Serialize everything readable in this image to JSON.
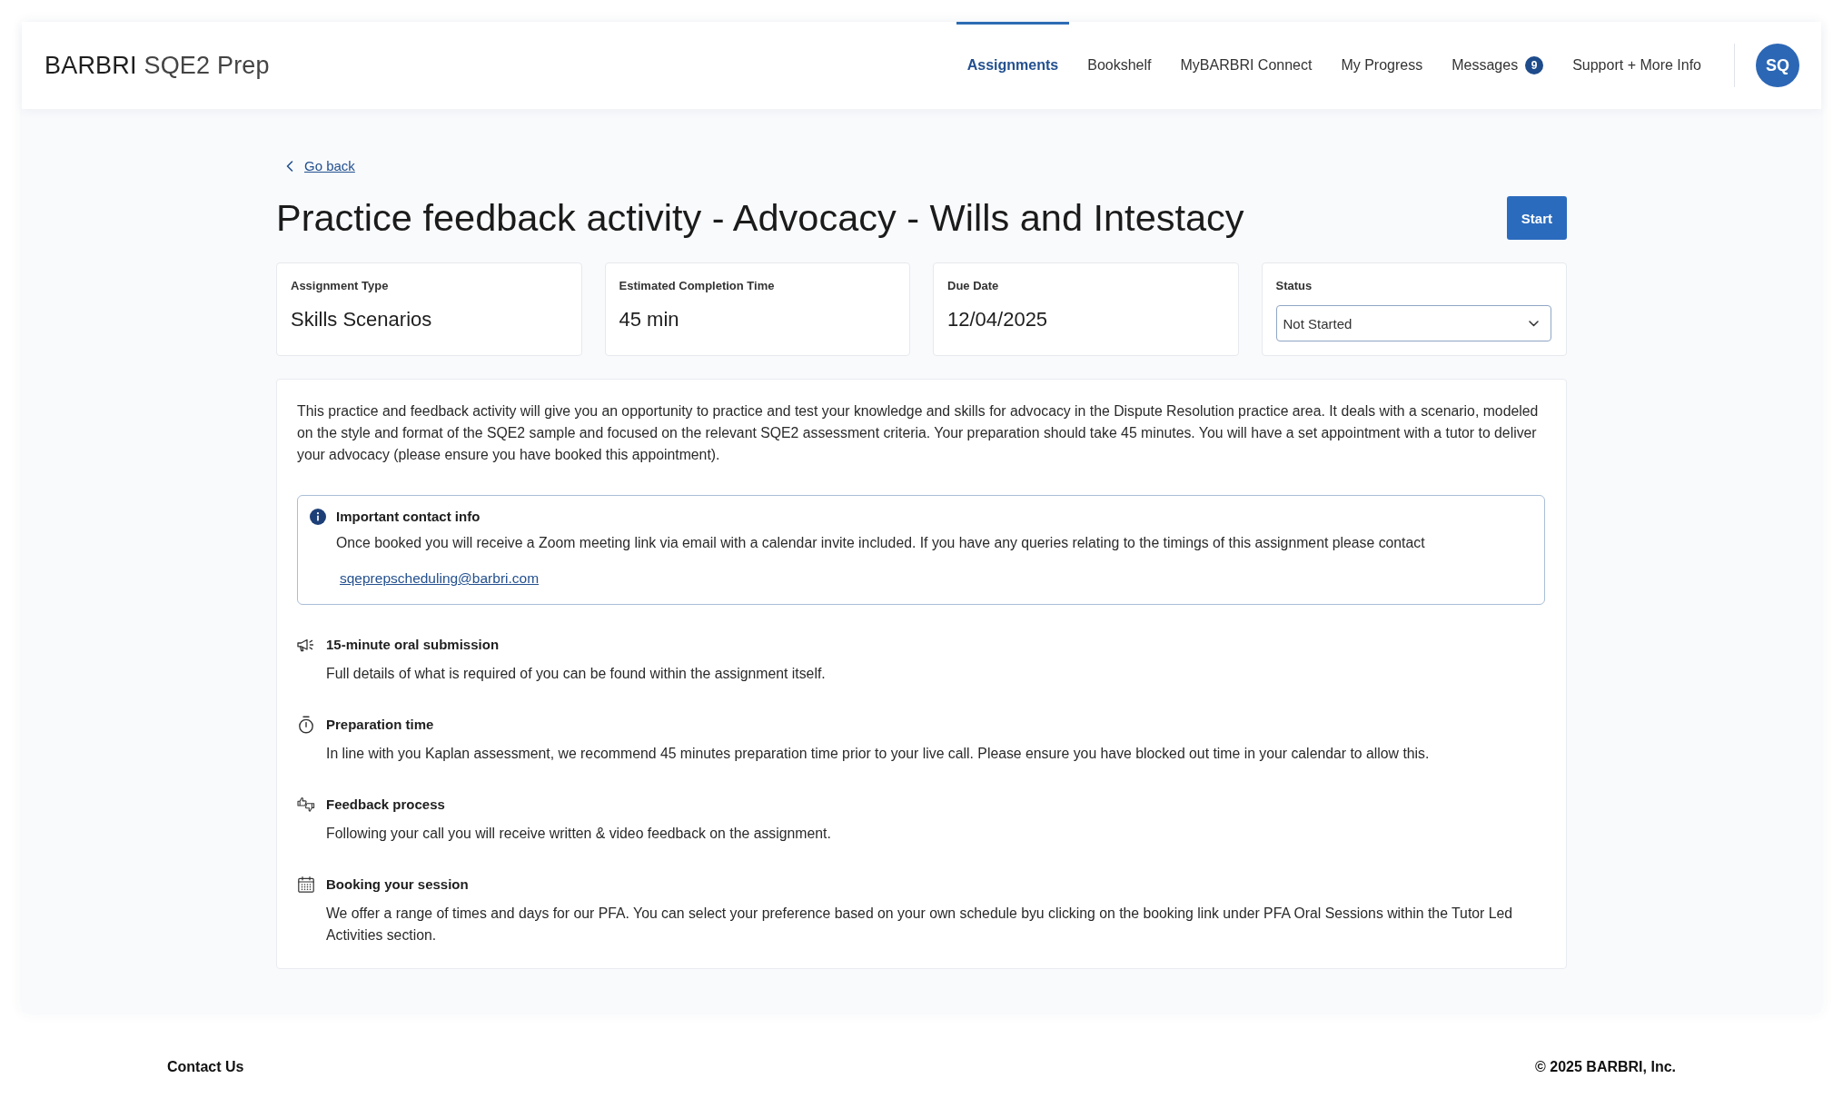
{
  "header": {
    "logo": {
      "brand": "BARBRI",
      "product": "SQE2 Prep"
    },
    "nav": [
      {
        "label": "Assignments",
        "selected": true
      },
      {
        "label": "Bookshelf",
        "selected": false
      },
      {
        "label": "MyBARBRI Connect",
        "selected": false
      },
      {
        "label": "My Progress",
        "selected": false
      },
      {
        "label": "Messages",
        "selected": false,
        "badge": "9"
      },
      {
        "label": "Support + More Info",
        "selected": false
      }
    ],
    "avatar": "SQ"
  },
  "assignment": {
    "back_link": "Go back",
    "title": "Practice feedback activity - Advocacy - Wills and Intestacy",
    "start_button": "Start",
    "details": [
      {
        "kind": "text",
        "label": "Assignment Type",
        "value": "Skills Scenarios"
      },
      {
        "kind": "text",
        "label": "Estimated Completion Time",
        "value": "45 min"
      },
      {
        "kind": "text",
        "label": "Due Date",
        "value": "12/04/2025"
      },
      {
        "kind": "select",
        "label": "Status",
        "value": "Not Started"
      }
    ],
    "description": "This practice and feedback activity will give you an opportunity to practice and test your knowledge and skills for advocacy in the Dispute Resolution practice area. It deals with a scenario, modeled on the style and format of the SQE2 sample and focused on the relevant SQE2 assessment criteria. Your preparation should take 45 minutes. You will have a set appointment with a tutor to deliver your advocacy (please ensure you have booked this appointment).",
    "notice": {
      "title": "Important contact info",
      "text": "Once booked you will receive a Zoom meeting link via email with a calendar invite included. If you have any queries relating to the timings of this assignment please contact",
      "link": "sqeprepscheduling@barbri.com"
    },
    "sections": [
      {
        "kind": "submission",
        "title": "15-minute oral submission",
        "text": "Full details of what is required of you can be found within the assignment itself."
      },
      {
        "kind": "timing",
        "title": "Preparation time",
        "text": "In line with you Kaplan assessment, we recommend 45 minutes preparation time prior to your live call. Please ensure you have blocked out time in your calendar to allow this."
      },
      {
        "kind": "feedback",
        "title": "Feedback process",
        "text": "Following your call you will receive written & video feedback on the assignment."
      },
      {
        "kind": "scheduling",
        "title": "Booking your session",
        "text": "We offer a range of times and days for our PFA. You can select your preference based on your own schedule byu clicking on the booking link under PFA Oral Sessions within the Tutor Led Activities section."
      }
    ]
  },
  "footer": {
    "link": "Contact Us",
    "copyright": "© 2025 BARBRI, Inc."
  }
}
